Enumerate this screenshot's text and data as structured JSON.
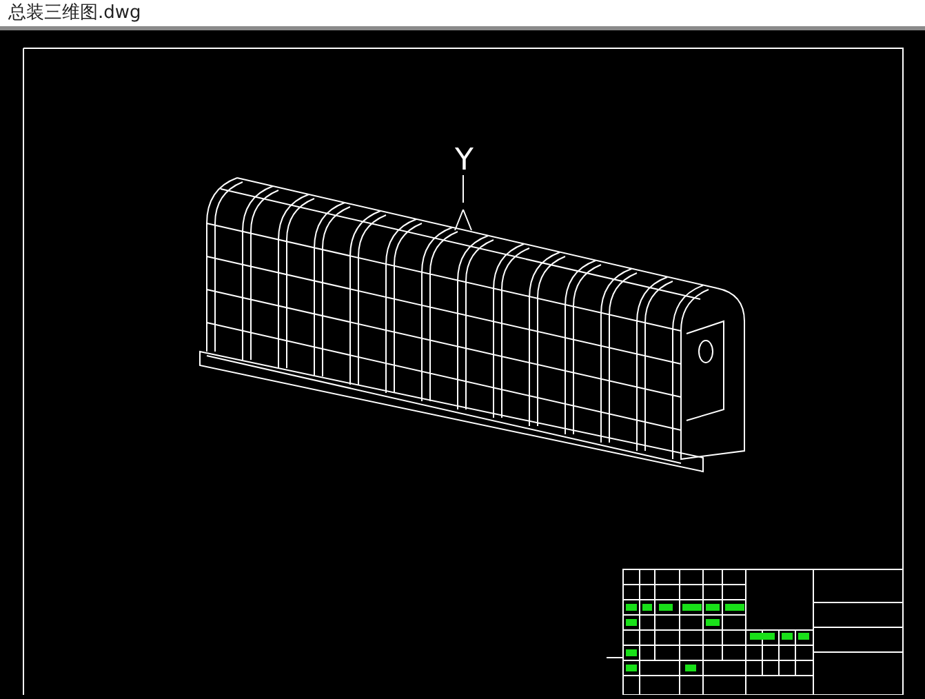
{
  "window": {
    "title": "总装三维图.dwg"
  },
  "canvas": {
    "axis_label": "Y"
  }
}
